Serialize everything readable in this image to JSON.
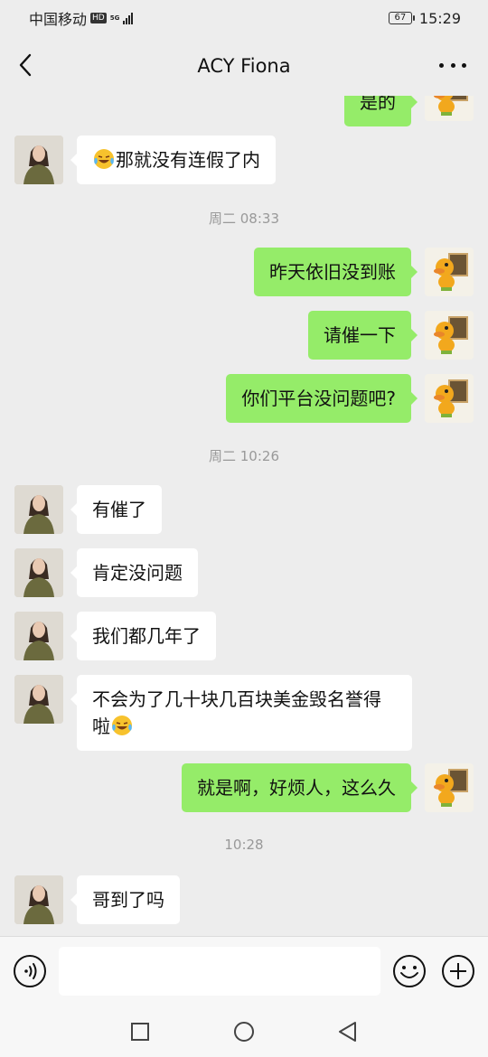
{
  "status_bar": {
    "carrier": "中国移动",
    "hd": "HD",
    "network": "5G",
    "battery": "67",
    "time": "15:29"
  },
  "header": {
    "title": "ACY Fiona"
  },
  "messages": [
    {
      "id": "m0",
      "side": "right",
      "text": "是的"
    },
    {
      "id": "m1",
      "side": "left",
      "emoji": "laugh-cry",
      "text": "那就没有连假了内"
    },
    {
      "id": "t1",
      "type": "time",
      "text": "周二 08:33"
    },
    {
      "id": "m2",
      "side": "right",
      "text": "昨天依旧没到账"
    },
    {
      "id": "m3",
      "side": "right",
      "text": "请催一下"
    },
    {
      "id": "m4",
      "side": "right",
      "text": "你们平台没问题吧?"
    },
    {
      "id": "t2",
      "type": "time",
      "text": "周二 10:26"
    },
    {
      "id": "m5",
      "side": "left",
      "text": "有催了"
    },
    {
      "id": "m6",
      "side": "left",
      "text": "肯定没问题"
    },
    {
      "id": "m7",
      "side": "left",
      "text": "我们都几年了"
    },
    {
      "id": "m8",
      "side": "left",
      "text": "不会为了几十块几百块美金毁名誉得啦",
      "emoji_after": "laugh-cry"
    },
    {
      "id": "m9",
      "side": "right",
      "text": "就是啊，好烦人，这么久"
    },
    {
      "id": "t3",
      "type": "time",
      "text": "10:28"
    },
    {
      "id": "m10",
      "side": "left",
      "text": "哥到了吗"
    }
  ],
  "input_bar": {
    "placeholder": ""
  },
  "icons": {
    "back": "chevron-left-icon",
    "more": "more-dots-icon",
    "voice": "voice-icon",
    "emoji": "emoji-icon",
    "plus": "plus-icon",
    "nav_recents": "square-icon",
    "nav_home": "circle-icon",
    "nav_back": "triangle-back-icon"
  },
  "colors": {
    "background": "#ededed",
    "bubble_self": "#95ec69",
    "bubble_other": "#ffffff",
    "timestamp": "#999999"
  }
}
